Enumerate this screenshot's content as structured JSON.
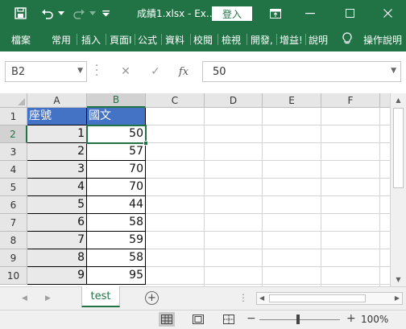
{
  "titlebar": {
    "title": "成績1.xlsx  -  Ex...",
    "login_label": "登入",
    "save_icon": "save-icon",
    "undo_icon": "undo-icon",
    "redo_icon": "redo-icon"
  },
  "ribbon": {
    "tabs": [
      "檔案",
      "常用",
      "插入",
      "頁面I",
      "公式",
      "資料",
      "校閱",
      "檢視",
      "開發,",
      "增益!",
      "說明",
      "操作說明"
    ]
  },
  "formula_bar": {
    "name_box": "B2",
    "fx_label": "fx",
    "value": "50"
  },
  "columns": [
    "A",
    "B",
    "C",
    "D",
    "E",
    "F"
  ],
  "rows": [
    "1",
    "2",
    "3",
    "4",
    "5",
    "6",
    "7",
    "8",
    "9",
    "10"
  ],
  "cells": {
    "header": [
      "座號",
      "國文"
    ],
    "data": [
      [
        "1",
        "50"
      ],
      [
        "2",
        "57"
      ],
      [
        "3",
        "70"
      ],
      [
        "4",
        "70"
      ],
      [
        "5",
        "44"
      ],
      [
        "6",
        "58"
      ],
      [
        "7",
        "59"
      ],
      [
        "8",
        "58"
      ],
      [
        "9",
        "95"
      ]
    ]
  },
  "active_cell": "B2",
  "sheet_tabs": [
    {
      "label": "test",
      "active": true
    }
  ],
  "status": {
    "zoom": "100%"
  },
  "colors": {
    "accent": "#217346",
    "header_fill": "#4472c4"
  }
}
